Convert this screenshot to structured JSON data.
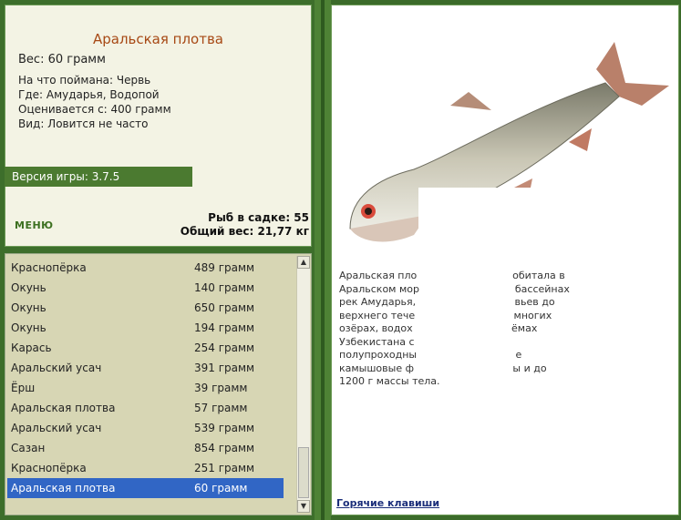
{
  "fish": {
    "title": "Аральская плотва",
    "weight": "Вес: 60 грамм",
    "details": [
      "На что поймана: Червь",
      "Где: Амударья, Водопой",
      "Оценивается с: 400 грамм",
      "Вид: Ловится не часто"
    ]
  },
  "version": "Версия игры: 3.7.5",
  "menu_label": "МЕНЮ",
  "stats": {
    "in_cage": "Рыб в садке: 55",
    "total_weight": "Общий вес: 21,77 кг"
  },
  "catch_list": [
    {
      "name": "Краснопёрка",
      "weight": "489 грамм"
    },
    {
      "name": "Окунь",
      "weight": "140 грамм"
    },
    {
      "name": "Окунь",
      "weight": "650 грамм"
    },
    {
      "name": "Окунь",
      "weight": "194 грамм"
    },
    {
      "name": "Карась",
      "weight": "254 грамм"
    },
    {
      "name": "Аральский усач",
      "weight": "391 грамм"
    },
    {
      "name": "Ёрш",
      "weight": "39 грамм"
    },
    {
      "name": "Аральская плотва",
      "weight": "57 грамм"
    },
    {
      "name": "Аральский усач",
      "weight": "539 грамм"
    },
    {
      "name": "Сазан",
      "weight": "854 грамм"
    },
    {
      "name": "Краснопёрка",
      "weight": "251 грамм"
    },
    {
      "name": "Аральская плотва",
      "weight": "60 грамм",
      "selected": true
    }
  ],
  "description_lines": [
    "Аральская пло                              обитала в",
    "Аральском мор                              бассейнах",
    "рек Амударья,                               вьев до",
    "верхнего тече                               многих",
    "озёрах, водох                               ёмах",
    "Узбекистана с",
    "полупроходны                               е",
    "камышовые ф                               ы и до",
    "1200 г массы тела."
  ],
  "hotkeys_label": "Горячие клавиши",
  "icons": {
    "scroll_up": "scroll-up-arrow-icon",
    "scroll_down": "scroll-down-arrow-icon"
  }
}
